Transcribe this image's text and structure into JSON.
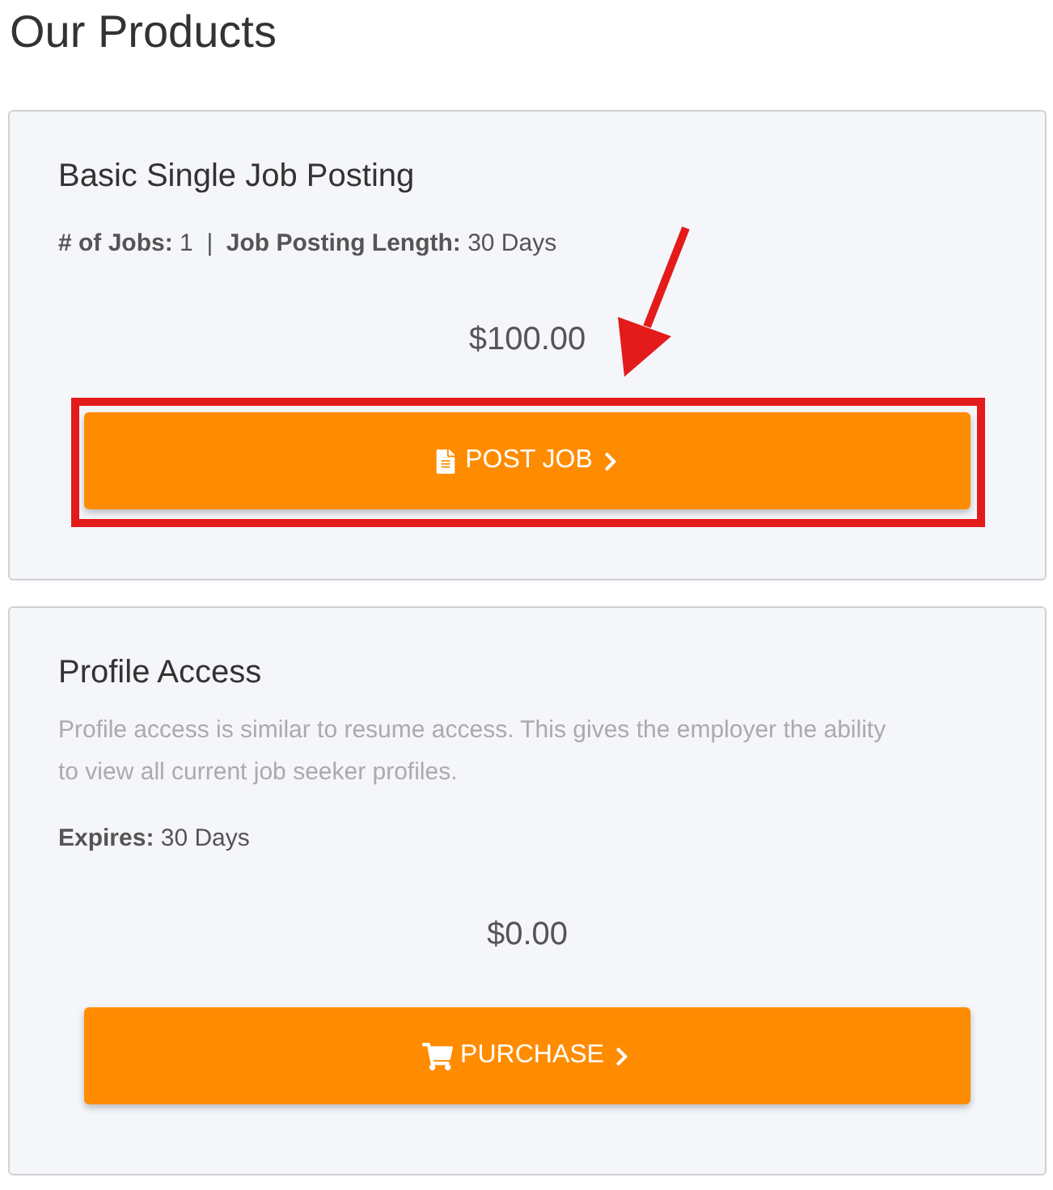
{
  "page": {
    "title": "Our Products"
  },
  "products": [
    {
      "kind": "posting",
      "name": "Basic Single Job Posting",
      "details": "**# of Jobs:** 1  |  **Job Posting Length:** 30 Days",
      "price": "$100.00",
      "button": "POST JOB",
      "highlighted": true
    },
    {
      "kind": "access",
      "name": "Profile Access",
      "description": "Profile access is similar to resume access. This gives the employer the ability to view all current job seeker profiles.",
      "details": "**Expires:** 30 Days",
      "price": "$0.00",
      "button": "PURCHASE",
      "highlighted": false
    }
  ]
}
